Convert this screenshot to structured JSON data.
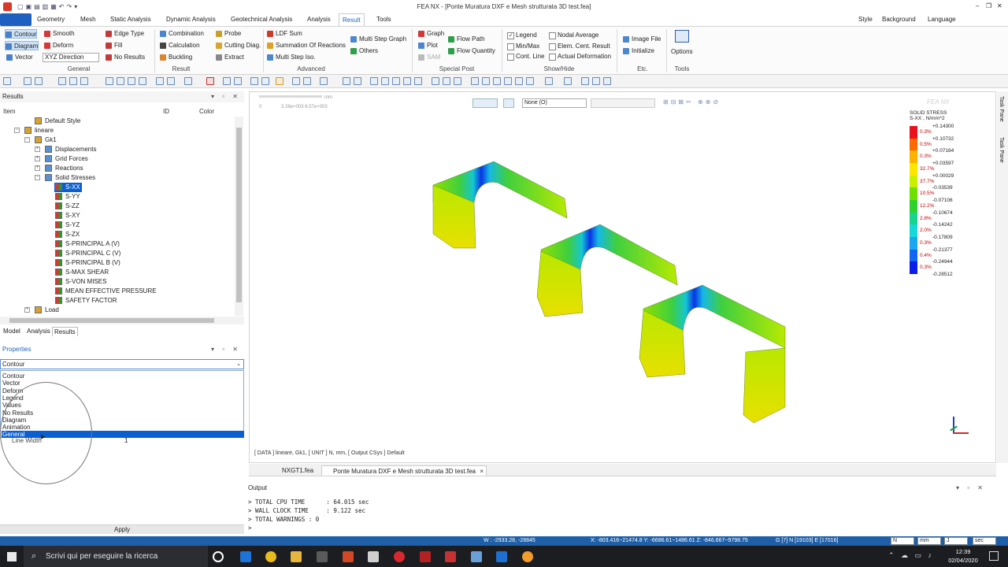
{
  "app": {
    "title": "FEA NX - [Ponte Muratura DXF e Mesh strutturata 3D test.fea]"
  },
  "window_controls": {
    "minimize": "–",
    "restore": "❐",
    "close": "✕"
  },
  "menu": {
    "tabs": [
      "Geometry",
      "Mesh",
      "Static Analysis",
      "Dynamic Analysis",
      "Geotechnical Analysis",
      "Analysis",
      "Result",
      "Tools"
    ],
    "active": "Result",
    "right": [
      "Style",
      "Background",
      "Language"
    ]
  },
  "ribbon": {
    "general": {
      "contour": "Contour",
      "diagram": "Diagram",
      "vector": "Vector",
      "smooth": "Smooth",
      "deform": "Deform",
      "xyz_direction": "XYZ Direction",
      "edge_type": "Edge Type",
      "fill": "Fill",
      "no_results": "No Results",
      "label": "General"
    },
    "result": {
      "combination": "Combination",
      "calculation": "Calculation",
      "buckling": "Buckling",
      "probe": "Probe",
      "cutting_diag": "Cutting Diag.",
      "extract": "Extract",
      "label": "Result"
    },
    "advanced": {
      "ldf_sum": "LDF Sum",
      "summation": "Summation Of Reactions",
      "multi_step_iso": "Multi Step Iso.",
      "multi_step_graph": "Multi Step Graph",
      "others": "Others",
      "label": "Advanced"
    },
    "special_post": {
      "graph": "Graph",
      "plot": "Plot",
      "sam": "SAM",
      "flow_path": "Flow Path",
      "flow_quantity": "Flow Quantity",
      "label": "Special Post"
    },
    "show_hide": {
      "legend": "Legend",
      "min_max": "Min/Max",
      "cont_line": "Cont. Line",
      "nodal_average": "Nodal Average",
      "elem_cent_result": "Elem. Cent. Result",
      "actual_deformation": "Actual Deformation",
      "label": "Show/Hide"
    },
    "etc": {
      "image_file": "Image File",
      "initialize": "Initialize",
      "label": "Etc."
    },
    "tools": {
      "options": "Options",
      "label": "Tools"
    }
  },
  "results_panel": {
    "title": "Results",
    "columns": [
      "Item",
      "ID",
      "Color"
    ],
    "tree": [
      {
        "label": "Default Style",
        "indent": 1
      },
      {
        "label": "lineare",
        "indent": 0
      },
      {
        "label": "Gk1",
        "indent": 1
      },
      {
        "label": "Displacements",
        "indent": 2
      },
      {
        "label": "Grid Forces",
        "indent": 2
      },
      {
        "label": "Reactions",
        "indent": 2
      },
      {
        "label": "Solid Stresses",
        "indent": 2
      },
      {
        "label": "S-XX",
        "indent": 3,
        "selected": true
      },
      {
        "label": "S-YY",
        "indent": 3
      },
      {
        "label": "S-ZZ",
        "indent": 3
      },
      {
        "label": "S-XY",
        "indent": 3
      },
      {
        "label": "S-YZ",
        "indent": 3
      },
      {
        "label": "S-ZX",
        "indent": 3
      },
      {
        "label": "S-PRINCIPAL A (V)",
        "indent": 3
      },
      {
        "label": "S-PRINCIPAL C (V)",
        "indent": 3
      },
      {
        "label": "S-PRINCIPAL B (V)",
        "indent": 3
      },
      {
        "label": "S-MAX SHEAR",
        "indent": 3
      },
      {
        "label": "S-VON MISES",
        "indent": 3
      },
      {
        "label": "MEAN EFFECTIVE PRESSURE",
        "indent": 3
      },
      {
        "label": "SAFETY FACTOR",
        "indent": 3
      },
      {
        "label": "Load",
        "indent": 1
      }
    ],
    "tabs": [
      "Model",
      "Analysis",
      "Results"
    ],
    "active_tab": "Results"
  },
  "properties_panel": {
    "title": "Properties",
    "selected": "Contour",
    "options": [
      "Contour",
      "Vector",
      "Deform",
      "Legend",
      "Values",
      "No Results",
      "Diagram",
      "Animation",
      "General"
    ],
    "highlighted": "General",
    "line_width_label": "Line Width",
    "line_width_value": "1",
    "apply": "Apply"
  },
  "viewport": {
    "scale_values": "3.28e+003  6.57e+003",
    "scale_zero": "0",
    "scale_unit": "mm",
    "view_select": "None (O)",
    "watermark": "FEA NX",
    "info_line": "[ DATA ] lineare, Gk1, [ UNIT ]  N, mm, [ Output CSys ]  Default",
    "task_pane": "Task Pane"
  },
  "legend": {
    "title": "SOLID STRESS",
    "subtitle": "S-XX , N/mm^2",
    "values": [
      "+0.14300",
      "+0.10732",
      "+0.07164",
      "+0.03597",
      "+0.00029",
      "-0.03539",
      "-0.07106",
      "-0.10674",
      "-0.14242",
      "-0.17809",
      "-0.21377",
      "-0.24944",
      "-0.28512"
    ],
    "percents": [
      "0.3%",
      "0.5%",
      "0.3%",
      "32.7%",
      "37.7%",
      "10.5%",
      "12.2%",
      "2.8%",
      "2.0%",
      "0.3%",
      "0.4%",
      "0.3%"
    ],
    "colors": [
      "#e8131c",
      "#ff6a00",
      "#ffb300",
      "#ffe600",
      "#c8f000",
      "#6ee000",
      "#2ed12e",
      "#18d48e",
      "#16d8d8",
      "#1aa6f0",
      "#1466f2",
      "#0b1ee8"
    ]
  },
  "doc_tabs": [
    {
      "label": "NXGT1.fea"
    },
    {
      "label": "Ponte Muratura DXF e Mesh strutturata 3D test.fea",
      "active": true,
      "close": "×"
    }
  ],
  "output": {
    "title": "Output",
    "lines": [
      "> TOTAL CPU TIME      : 64.015 sec",
      "> WALL CLOCK TIME     : 9.122 sec",
      "> TOTAL WARNINGS : 0",
      ">"
    ]
  },
  "statusbar": {
    "w": "W : -2933.28, -28845",
    "coords": "X: -803.416~21474.8 Y: -6686.61~1486.61 Z: -846.667~9798.75",
    "counts": "G [7] N [19103] E [17016]",
    "unit_force": "N",
    "unit_length": "mm",
    "unit_energy": "J",
    "unit_time": "sec"
  },
  "taskbar": {
    "search": "Scrivi qui per eseguire la ricerca",
    "time": "12:39",
    "date": "02/04/2020"
  }
}
